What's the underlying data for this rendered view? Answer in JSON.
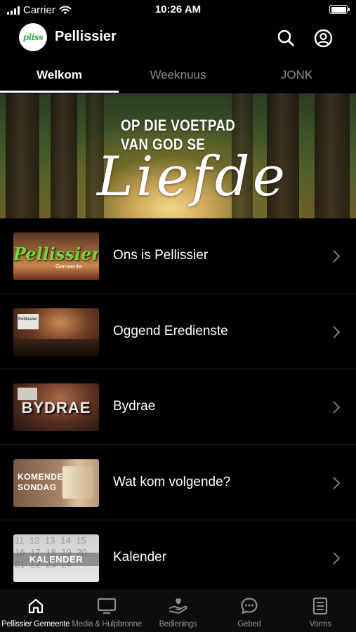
{
  "status_bar": {
    "carrier": "Carrier",
    "time": "10:26 AM"
  },
  "header": {
    "logo_text": "pliss",
    "title": "Pellissier"
  },
  "tabs": [
    {
      "label": "Welkom",
      "active": true
    },
    {
      "label": "Weeknuus",
      "active": false
    },
    {
      "label": "JONK",
      "active": false
    }
  ],
  "hero": {
    "line1": "OP DIE VOETPAD",
    "line2": "VAN GOD SE",
    "script": "Liefde"
  },
  "list": [
    {
      "label": "Ons is Pellissier",
      "thumb_text": "Pellissier",
      "thumb_sub": "Gemeente"
    },
    {
      "label": "Oggend Eredienste",
      "thumb_text": "Pellissier"
    },
    {
      "label": "Bydrae",
      "thumb_text": "BYDRAE"
    },
    {
      "label": "Wat kom volgende?",
      "thumb_line1": "KOMENDE",
      "thumb_line2": "SONDAG"
    },
    {
      "label": "Kalender",
      "thumb_text": "KALENDER",
      "thumb_numbers": "11 12 13 14 15 16 17 18 19 20 21 22 23 24"
    }
  ],
  "bottom_nav": [
    {
      "label": "Pellissier Gemeente",
      "icon": "home-icon",
      "active": true
    },
    {
      "label": "Media & Hulpbronne",
      "icon": "tv-icon",
      "active": false
    },
    {
      "label": "Bedienings",
      "icon": "heart-hand-icon",
      "active": false
    },
    {
      "label": "Gebed",
      "icon": "chat-icon",
      "active": false
    },
    {
      "label": "Vorms",
      "icon": "form-icon",
      "active": false
    }
  ],
  "colors": {
    "background": "#000000",
    "inactive": "#8d8d8d",
    "logo_green": "#3aa84a"
  }
}
